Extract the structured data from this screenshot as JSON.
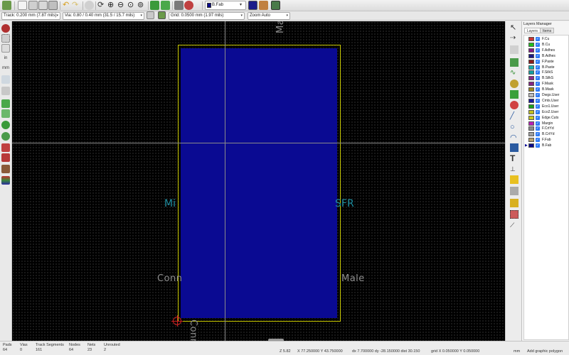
{
  "toolbar": {
    "active_layer": "B.Fab",
    "layer_color": "#0b0b8a"
  },
  "toolbar2": {
    "track": "Track: 0.200 mm (7.87 mils)",
    "via": "Via: 0.80 / 0.40 mm (31.5 / 15.7 mils)",
    "grid": "Grid: 0.0500 mm (1.97 mils)",
    "zoom": "Zoom Auto"
  },
  "canvas": {
    "texts": {
      "top_rotated": "Male",
      "mid_left": "Mi",
      "mid_right": "SFR",
      "bottom_left": "Conn",
      "bottom_right": "Male",
      "bottom_rotated": "Conn"
    },
    "fab_color": "#0a0a92",
    "outline_color": "#c8c800"
  },
  "layers_manager": {
    "title": "Layers Manager",
    "tabs": [
      "Layers",
      "Items"
    ],
    "layers": [
      {
        "name": "F.Cu",
        "color": "#c83434"
      },
      {
        "name": "B.Cu",
        "color": "#20c020"
      },
      {
        "name": "F.Adhes",
        "color": "#841b84"
      },
      {
        "name": "B.Adhes",
        "color": "#1b1b84"
      },
      {
        "name": "F.Paste",
        "color": "#8a1c1c"
      },
      {
        "name": "B.Paste",
        "color": "#17b0b0"
      },
      {
        "name": "F.SilkS",
        "color": "#14a0a0"
      },
      {
        "name": "B.SilkS",
        "color": "#8a2a8a"
      },
      {
        "name": "F.Mask",
        "color": "#842484"
      },
      {
        "name": "B.Mask",
        "color": "#a08a20"
      },
      {
        "name": "Dwgs.User",
        "color": "#bcbcbc"
      },
      {
        "name": "Cmts.User",
        "color": "#1b1b9a"
      },
      {
        "name": "Eco1.User",
        "color": "#1ba01b"
      },
      {
        "name": "Eco2.User",
        "color": "#c0c020"
      },
      {
        "name": "Edge.Cuts",
        "color": "#c8c820"
      },
      {
        "name": "Margin",
        "color": "#b820b8"
      },
      {
        "name": "F.CrtYd",
        "color": "#8a8a8a"
      },
      {
        "name": "B.CrtYd",
        "color": "#a0a0a0"
      },
      {
        "name": "F.Fab",
        "color": "#b8a070"
      },
      {
        "name": "B.Fab",
        "color": "#0b0b8a"
      }
    ],
    "active_layer": "B.Fab"
  },
  "status": {
    "pads_label": "Pads",
    "pads": "64",
    "vias_label": "Vias",
    "vias": "0",
    "tracks_label": "Track Segments",
    "tracks": "161",
    "nodes_label": "Nodes",
    "nodes": "64",
    "nets_label": "Nets",
    "nets": "23",
    "unrouted_label": "Unrouted",
    "unrouted": "2",
    "zoom": "Z 5.82",
    "coords": "X 77.250000  Y 43.750000",
    "delta": "dx 7.700000  dy -28.150000  dist 30.150",
    "grid": "grid X 0.050000  Y 0.050000",
    "units": "mm",
    "message": "Add graphic polygon"
  }
}
